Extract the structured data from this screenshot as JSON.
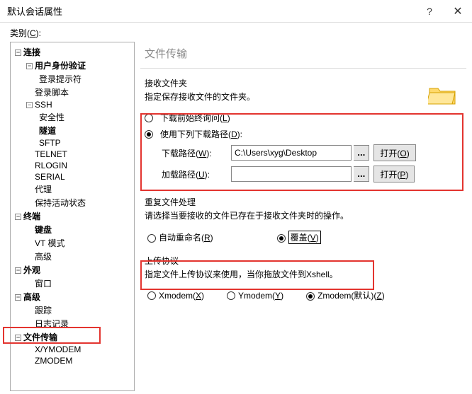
{
  "window": {
    "title": "默认会话属性",
    "help": "?",
    "close": "✕"
  },
  "category_label_prefix": "类别(",
  "category_key": "C",
  "category_label_suffix": "):",
  "tree": {
    "conn": "连接",
    "auth": "用户身份验证",
    "login_prompt": "登录提示符",
    "login_script": "登录脚本",
    "ssh": "SSH",
    "security": "安全性",
    "tunnel": "隧道",
    "sftp": "SFTP",
    "telnet": "TELNET",
    "rlogin": "RLOGIN",
    "serial": "SERIAL",
    "proxy": "代理",
    "keepalive": "保持活动状态",
    "terminal": "终端",
    "keyboard": "键盘",
    "vt": "VT 模式",
    "advanced1": "高级",
    "appearance": "外观",
    "windowtab": "窗口",
    "advanced2": "高级",
    "trace": "跟踪",
    "logging": "日志记录",
    "filetransfer": "文件传输",
    "xy": "X/YMODEM",
    "z": "ZMODEM"
  },
  "main": {
    "header": "文件传输",
    "recv_title": "接收文件夹",
    "recv_desc": "指定保存接收文件的文件夹。",
    "radio_ask_prefix": "下载前始终询问(",
    "radio_ask_key": "L",
    "radio_ask_suffix": ")",
    "radio_usepath_prefix": "使用下列下载路径(",
    "radio_usepath_key": "D",
    "radio_usepath_suffix": "):",
    "dlpath_label_prefix": "下载路径(",
    "dlpath_key": "W",
    "dlpath_label_suffix": "):",
    "dlpath_value": "C:\\Users\\xyg\\Desktop",
    "ldpath_label_prefix": "加载路径(",
    "ldpath_key": "U",
    "ldpath_label_suffix": "):",
    "ldpath_value": "",
    "open1_prefix": "打开(",
    "open1_key": "O",
    "open1_suffix": ")",
    "open2_prefix": "打开(",
    "open2_key": "P",
    "open2_suffix": ")",
    "dup_title": "重复文件处理",
    "dup_desc": "请选择当要接收的文件已存在于接收文件夹时的操作。",
    "rename_prefix": "自动重命名(",
    "rename_key": "R",
    "rename_suffix": ")",
    "overwrite_prefix": "覆盖(",
    "overwrite_key": "V",
    "overwrite_suffix": ")",
    "upload_title": "上传协议",
    "upload_desc": "指定文件上传协议来使用，当你拖放文件到Xshell。",
    "xm_prefix": "Xmodem(",
    "xm_key": "X",
    "xm_suffix": ")",
    "ym_prefix": "Ymodem(",
    "ym_key": "Y",
    "ym_suffix": ")",
    "zm_prefix": "Zmodem(默认)(",
    "zm_key": "Z",
    "zm_suffix": ")",
    "ellipsis": "..."
  }
}
